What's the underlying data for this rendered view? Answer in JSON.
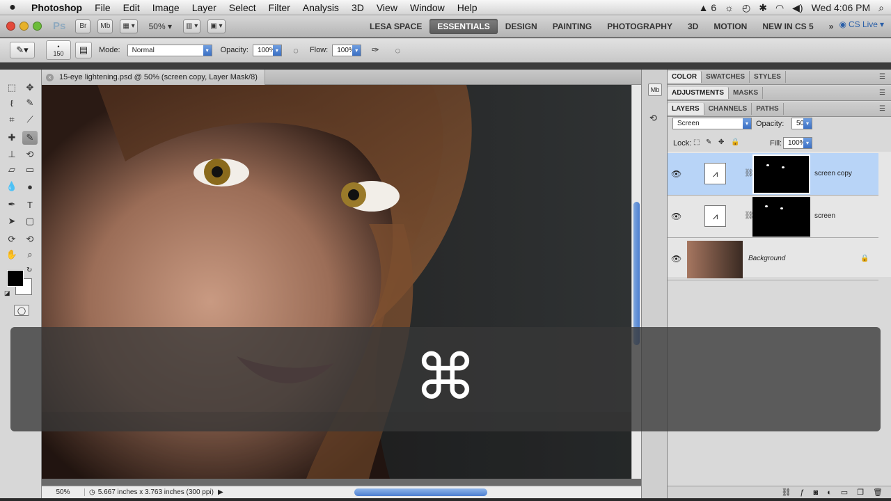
{
  "menubar": {
    "apple": "",
    "items": [
      "Photoshop",
      "File",
      "Edit",
      "Image",
      "Layer",
      "Select",
      "Filter",
      "Analysis",
      "3D",
      "View",
      "Window",
      "Help"
    ],
    "status": {
      "adobe_count": "6",
      "clock": "Wed 4:06 PM"
    }
  },
  "appbar": {
    "logo": "Ps",
    "bridge": "Br",
    "minibridge": "Mb",
    "zoom": "50%",
    "workspaces": [
      "LESA SPACE",
      "ESSENTIALS",
      "DESIGN",
      "PAINTING",
      "PHOTOGRAPHY",
      "3D",
      "MOTION",
      "NEW IN CS 5"
    ],
    "active_workspace": "ESSENTIALS",
    "overflow": "»",
    "cs_live": "CS Live"
  },
  "options": {
    "brush_size": "150",
    "mode_label": "Mode:",
    "mode_value": "Normal",
    "opacity_label": "Opacity:",
    "opacity_value": "100%",
    "flow_label": "Flow:",
    "flow_value": "100%"
  },
  "document": {
    "tab_title": "15-eye lightening.psd @ 50% (screen copy, Layer Mask/8)",
    "status_zoom": "50%",
    "status_info": "5.667 inches x 3.763 inches (300 ppi)"
  },
  "panels": {
    "color_tabs": [
      "COLOR",
      "SWATCHES",
      "STYLES"
    ],
    "adjust_tabs": [
      "ADJUSTMENTS",
      "MASKS"
    ],
    "layers_tabs": [
      "LAYERS",
      "CHANNELS",
      "PATHS"
    ],
    "blend_mode": "Screen",
    "opacity_label": "Opacity:",
    "opacity_value": "50%",
    "lock_label": "Lock:",
    "fill_label": "Fill:",
    "fill_value": "100%",
    "layers": [
      {
        "name": "screen copy",
        "active": true
      },
      {
        "name": "screen",
        "active": false
      },
      {
        "name": "Background",
        "active": false
      }
    ]
  },
  "overlay": {
    "key": "⌘"
  },
  "colors": {
    "accent": "#3a6fc4",
    "selection": "#b8d4f7"
  }
}
